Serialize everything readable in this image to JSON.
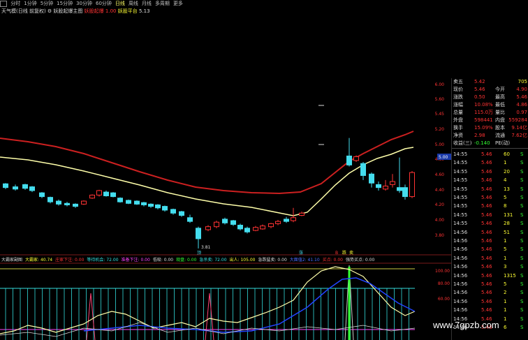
{
  "toolbar": {
    "items": [
      "分时",
      "1分钟",
      "5分钟",
      "15分钟",
      "30分钟",
      "60分钟",
      "日线",
      "周线",
      "月线",
      "多周期",
      "更多"
    ],
    "active": "日线"
  },
  "indicator_line": {
    "name": "天气模(日线 前复权)",
    "formula": "妖股起爆主图",
    "signal1": "妖股起爆",
    "signal1_value": "1.00",
    "signal2": "妖股平台",
    "signal2_value": "5.13"
  },
  "price_axis": [
    "6.00",
    "5.60",
    "5.45",
    "5.20",
    "5.00",
    "4.80",
    "4.60",
    "4.40",
    "4.20",
    "4.00",
    "3.80"
  ],
  "current_price_tag": "5.00",
  "low_label": "3.81",
  "markers": [
    "顶",
    "涨",
    "B",
    "跌",
    "卖"
  ],
  "bottom_legend": [
    {
      "label": "大霸家副图",
      "value": "",
      "color": "white"
    },
    {
      "label": "大霸家:",
      "value": "40.74",
      "color": "yellow"
    },
    {
      "label": "庄家下注:",
      "value": "0.00",
      "color": "red"
    },
    {
      "label": "等待机会:",
      "value": "72.00",
      "color": "cyan"
    },
    {
      "label": "准备下注:",
      "value": "0.00",
      "color": "mag"
    },
    {
      "label": "低吸:",
      "value": "0.00",
      "color": "white"
    },
    {
      "label": "观盘:",
      "value": "0.00",
      "color": "green"
    },
    {
      "label": "急杀卖:",
      "value": "72.00",
      "color": "cyan"
    },
    {
      "label": "出人:",
      "value": "105.00",
      "color": "yellow"
    },
    {
      "label": "急跌猛卖:",
      "value": "0.00",
      "color": "white"
    },
    {
      "label": "大面值2:",
      "value": "41.10",
      "color": "blue"
    },
    {
      "label": "买点:",
      "value": "0.00",
      "color": "red"
    },
    {
      "label": "强势买点:",
      "value": "0.00",
      "color": "white"
    }
  ],
  "bottom_axis": [
    "100.00",
    "80.00",
    "60.00"
  ],
  "quote": {
    "rows": [
      {
        "label": "卖五",
        "value": "5.42",
        "right": "705"
      },
      {
        "label": "现价",
        "value": "5.46",
        "mid": "今开",
        "right": "4.90"
      },
      {
        "label": "涨跌",
        "value": "0.50",
        "mid": "最高",
        "right": "5.46"
      },
      {
        "label": "涨幅",
        "value": "10.08%",
        "mid": "最低",
        "right": "4.86"
      },
      {
        "label": "总量",
        "value": "115.0万",
        "mid": "量比",
        "right": "0.97"
      },
      {
        "label": "外盘",
        "value": "598441",
        "mid": "内盘",
        "right": "559284"
      },
      {
        "label": "换手",
        "value": "15.09%",
        "mid": "股本",
        "right": "9.14亿"
      },
      {
        "label": "净资",
        "value": "2.98",
        "mid": "流通",
        "right": "7.62亿"
      },
      {
        "label": "收益(三)",
        "value": "-0.140",
        "mid": "PE(动)",
        "right": ""
      }
    ]
  },
  "ticks": [
    {
      "time": "14:55",
      "price": "5.46",
      "vol": "60",
      "side": "S"
    },
    {
      "time": "14:55",
      "price": "5.46",
      "vol": "1",
      "side": "S"
    },
    {
      "time": "14:55",
      "price": "5.46",
      "vol": "20",
      "side": "S"
    },
    {
      "time": "14:55",
      "price": "5.46",
      "vol": "4",
      "side": "S"
    },
    {
      "time": "14:55",
      "price": "5.46",
      "vol": "13",
      "side": "S"
    },
    {
      "time": "14:55",
      "price": "5.46",
      "vol": "5",
      "side": "S"
    },
    {
      "time": "14:55",
      "price": "5.46",
      "vol": "8",
      "side": "S"
    },
    {
      "time": "14:55",
      "price": "5.46",
      "vol": "131",
      "side": "S"
    },
    {
      "time": "14:55",
      "price": "5.46",
      "vol": "28",
      "side": "S"
    },
    {
      "time": "14:56",
      "price": "5.46",
      "vol": "51",
      "side": "S"
    },
    {
      "time": "14:56",
      "price": "5.46",
      "vol": "1",
      "side": "S"
    },
    {
      "time": "14:56",
      "price": "5.46",
      "vol": "5",
      "side": "S"
    },
    {
      "time": "14:56",
      "price": "5.46",
      "vol": "1",
      "side": "S"
    },
    {
      "time": "14:56",
      "price": "5.46",
      "vol": "3",
      "side": "S"
    },
    {
      "time": "14:56",
      "price": "5.46",
      "vol": "1315",
      "side": "S"
    },
    {
      "time": "14:56",
      "price": "5.46",
      "vol": "5",
      "side": "S"
    },
    {
      "time": "14:56",
      "price": "5.46",
      "vol": "2",
      "side": "S"
    },
    {
      "time": "14:56",
      "price": "5.46",
      "vol": "1",
      "side": "S"
    },
    {
      "time": "14:56",
      "price": "5.46",
      "vol": "1",
      "side": "S"
    },
    {
      "time": "14:56",
      "price": "5.46",
      "vol": "1",
      "side": "S"
    },
    {
      "time": "14:56",
      "price": "5.46",
      "vol": "6",
      "side": "S"
    }
  ],
  "watermark": "www.7gpzb.com"
}
